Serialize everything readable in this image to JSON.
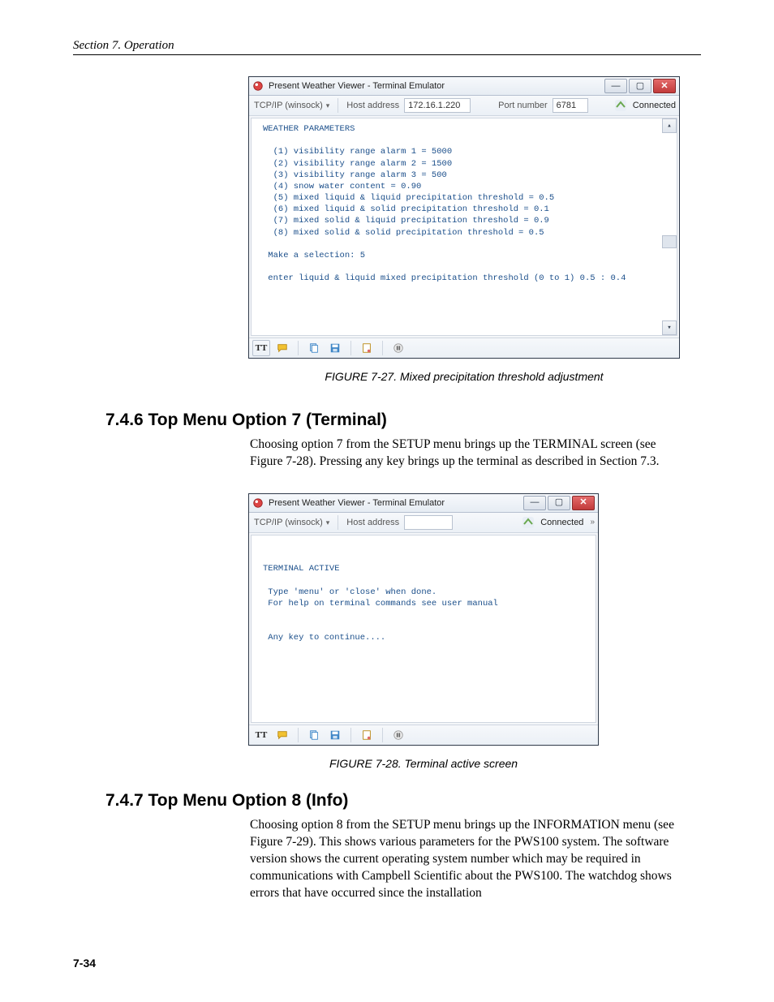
{
  "running_head": "Section 7.  Operation",
  "page_number": "7-34",
  "fig27": {
    "caption": "FIGURE 7-27.  Mixed precipitation threshold adjustment",
    "title": "Present Weather Viewer - Terminal Emulator",
    "conn_label": "TCP/IP (winsock)",
    "host_label": "Host address",
    "host_value": "172.16.1.220",
    "port_label": "Port number",
    "port_value": "6781",
    "connected": "Connected",
    "term_lines": "WEATHER PARAMETERS\n\n  (1) visibility range alarm 1 = 5000\n  (2) visibility range alarm 2 = 1500\n  (3) visibility range alarm 3 = 500\n  (4) snow water content = 0.90\n  (5) mixed liquid & liquid precipitation threshold = 0.5\n  (6) mixed liquid & solid precipitation threshold = 0.1\n  (7) mixed solid & liquid precipitation threshold = 0.9\n  (8) mixed solid & solid precipitation threshold = 0.5\n\n Make a selection: 5\n\n enter liquid & liquid mixed precipitation threshold (0 to 1) 0.5 : 0.4"
  },
  "sec746": {
    "heading": "7.4.6  Top Menu Option 7 (Terminal)",
    "para": "Choosing option 7 from the SETUP menu brings up the TERMINAL screen (see Figure 7-28). Pressing any key brings up the terminal as described in Section 7.3."
  },
  "fig28": {
    "caption": "FIGURE 7-28.  Terminal active screen",
    "title": "Present Weather Viewer - Terminal Emulator",
    "conn_label": "TCP/IP (winsock)",
    "host_label": "Host address",
    "connected": "Connected",
    "term_lines": "\n\nTERMINAL ACTIVE\n\n Type 'menu' or 'close' when done.\n For help on terminal commands see user manual\n\n\n Any key to continue....\n\n\n\n"
  },
  "sec747": {
    "heading": "7.4.7  Top Menu Option 8 (Info)",
    "para": "Choosing option 8 from the SETUP menu brings up the INFORMATION menu (see Figure 7-29). This shows various parameters for the PWS100 system. The software version shows the current operating system number which may be required in communications with Campbell Scientific about the PWS100. The watchdog shows errors that have occurred since the installation"
  },
  "icons": {
    "tt": "TT",
    "balloon": "chat-bubble",
    "copy": "copy",
    "disk": "disk",
    "page": "page",
    "pause": "pause"
  }
}
